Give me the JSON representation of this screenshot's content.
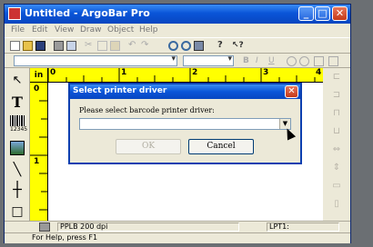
{
  "window": {
    "title": "Untitled - ArgoBar Pro",
    "controls": {
      "minimize": "_",
      "maximize": "□",
      "close": "✕"
    }
  },
  "menu": [
    "File",
    "Edit",
    "View",
    "Draw",
    "Object",
    "Help"
  ],
  "ruler": {
    "unit": "in",
    "top_numbers": [
      "0",
      "1",
      "2",
      "3",
      "4"
    ],
    "left_numbers": [
      "0",
      "1"
    ]
  },
  "left_tools": {
    "text_tool": "T",
    "barcode_caption": "12345"
  },
  "status": {
    "printer": "PPLB 200 dpi",
    "port": "LPT1:",
    "help": "For Help, press F1"
  },
  "dialog": {
    "title": "Select printer driver",
    "close": "✕",
    "prompt": "Please select barcode printer driver:",
    "selected_value": "",
    "ok_label": "OK",
    "cancel_label": "Cancel"
  },
  "colors": {
    "title_bar": "#0a55d8",
    "ruler": "#ffff00",
    "close_button": "#c43a1a",
    "window_face": "#ece9d8"
  }
}
